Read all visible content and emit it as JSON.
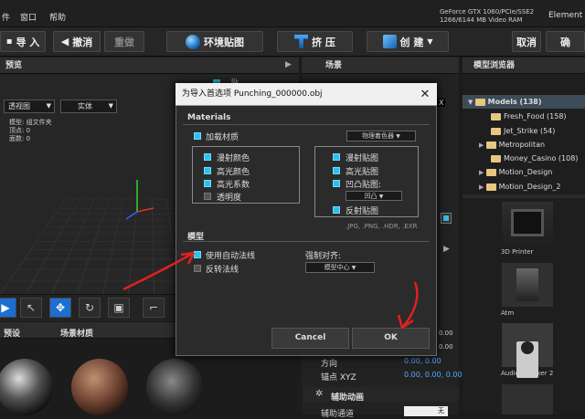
{
  "menubar": {
    "items": [
      "件",
      "窗口",
      "帮助"
    ],
    "gpu_line1": "GeForce GTX 1060/PCIe/SSE2",
    "gpu_line2": "1266/6144 MB Video RAM",
    "right_label": "Element"
  },
  "toolbar": {
    "import": "导 入",
    "undo": "撤消",
    "redo": "重做",
    "env": "环境贴图",
    "extrude": "挤 压",
    "create": "创 建",
    "cancel": "取消",
    "confirm": "确"
  },
  "left": {
    "preview_title": "预览",
    "view_mode": "透视图",
    "render_mode": "实体",
    "stat_model": "模型: 组文件夹",
    "stat_verts": "顶点: 0",
    "stat_faces": "面数: 0",
    "tab_preset": "预设",
    "tab_scene_mat": "场景材质",
    "partial_label": "贴"
  },
  "middle": {
    "title": "场景",
    "row_direction": "方向",
    "row_anchor": "锚点 XYZ",
    "dir_values": "0.00, 0.00",
    "anchor_values": "0.00, 0.00, 0.00",
    "section_aux": "辅助动画",
    "aux_row": "辅助通道",
    "aux_val": "无",
    "side_val1": "0.00",
    "side_val2": "0.00"
  },
  "right": {
    "title": "模型浏览器",
    "tree": [
      {
        "label": "Models (138)",
        "expanded": true
      },
      {
        "label": "Fresh_Food (158)"
      },
      {
        "label": "Jet_Strike (54)"
      },
      {
        "label": "Metropolitan"
      },
      {
        "label": "Money_Casino (108)"
      },
      {
        "label": "Motion_Design"
      },
      {
        "label": "Motion_Design_2"
      }
    ],
    "thumbs": [
      "3D Printer",
      "Atm",
      "Audio Speaker 2"
    ]
  },
  "dialog": {
    "title": "为导入首选项 Punching_000000.obj",
    "materials_section": "Materials",
    "load_materials": "加载材质",
    "material_dropdown": "物理着色器",
    "left_opts": [
      "漫射颜色",
      "高光颜色",
      "高光系数",
      "透明度"
    ],
    "right_opts": [
      "漫射贴图",
      "高光贴图",
      "凹凸贴图:",
      "反射贴图"
    ],
    "bump_dropdown": "凹凸",
    "formats": ".JPG, .PNG, .HDR, .EXR",
    "model_section": "模型",
    "auto_normals": "使用自动法线",
    "flip_normals": "反转法线",
    "force_align": "强制对齐:",
    "align_dropdown": "模型中心",
    "cancel": "Cancel",
    "ok": "OK"
  },
  "colors": {
    "accent": "#2fc0ea",
    "annotation": "#e02020"
  }
}
